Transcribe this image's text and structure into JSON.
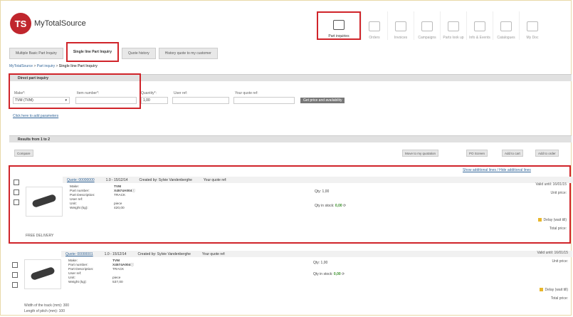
{
  "app": {
    "logo_badge": "TS",
    "logo_text": "MyTotalSource"
  },
  "nav": [
    {
      "label": "Part inquiries",
      "icon": "envelope-icon",
      "active": true
    },
    {
      "label": "Orders",
      "icon": "orders-icon"
    },
    {
      "label": "Invoices",
      "icon": "invoice-icon"
    },
    {
      "label": "Campaigns",
      "icon": "campaign-icon"
    },
    {
      "label": "Parts look up",
      "icon": "search-icon"
    },
    {
      "label": "Info & Events",
      "icon": "chart-icon"
    },
    {
      "label": "Catalogues",
      "icon": "catalogue-icon"
    },
    {
      "label": "My Doc",
      "icon": "doc-icon"
    }
  ],
  "tabs": [
    "Multiple Basic Part Inquiry",
    "Single line Part Inquiry",
    "Quote history",
    "History quote to my customer"
  ],
  "breadcrumb": {
    "home": "MyTotalSource",
    "parent": "Part inquiry",
    "current": "Single line Part Inquiry"
  },
  "direct": {
    "title": "Direct part inquiry",
    "make_label": "Make*:",
    "make_value": "TVM (TVM)",
    "item_label": "Item number*:",
    "qty_label": "Quantity*:",
    "qty_value": "1,00",
    "user_ref_label": "User ref:",
    "your_ref_label": "Your quote ref:",
    "button": "Get price and availability",
    "extra_link": "Click here to add parameters"
  },
  "results": {
    "title": "Results from 1 to 2",
    "compare_label": "Compare",
    "action_buttons": [
      "Move to my quotation",
      "PO Screen",
      "Add to cart",
      "Add to order"
    ],
    "show_links": "Show additional lines / Hide additional lines",
    "items": [
      {
        "quote": "Quote: 00000000",
        "line": "1.0 - 15/12/14",
        "created": "Created by: Sylvie Vandenberghe",
        "your_ref": "Your quote ref:",
        "make": "TVM",
        "part_number": "X4574A004",
        "description": "TRACK",
        "user_ref": "",
        "unit": "piece",
        "weight": "420,00",
        "qty": "Qty: 1,00",
        "stock_label": "Qty in stock:",
        "stock": "0,00",
        "valid": "Valid until: 16/01/15",
        "unit_price": "Unit price:",
        "delay": "Delay (wait till)",
        "total_price": "Total price:",
        "footnote": "FREE DELIVERY"
      },
      {
        "quote": "Quote: 00000001",
        "line": "1.0 - 15/12/14",
        "created": "Created by: Sylvie Vandenberghe",
        "your_ref": "Your quote ref:",
        "make": "TVM",
        "part_number": "X4574A004",
        "description": "TRACK",
        "user_ref": "",
        "unit": "piece",
        "weight": "537,00",
        "qty": "Qty: 1,00",
        "stock_label": "Qty in stock:",
        "stock": "0,00",
        "valid": "Valid until: 16/01/15",
        "unit_price": "Unit price:",
        "delay": "Delay (wait till)",
        "total_price": "Total price:",
        "footnote": "Width of the track (mm): 300",
        "footnote2": "Length of pitch (mm): 100"
      }
    ],
    "detail_labels": {
      "make": "Make:",
      "part_number": "Part number:",
      "description": "Part Description:",
      "user_ref": "User ref:",
      "unit": "Unit:",
      "weight": "Weight (kg):"
    }
  }
}
